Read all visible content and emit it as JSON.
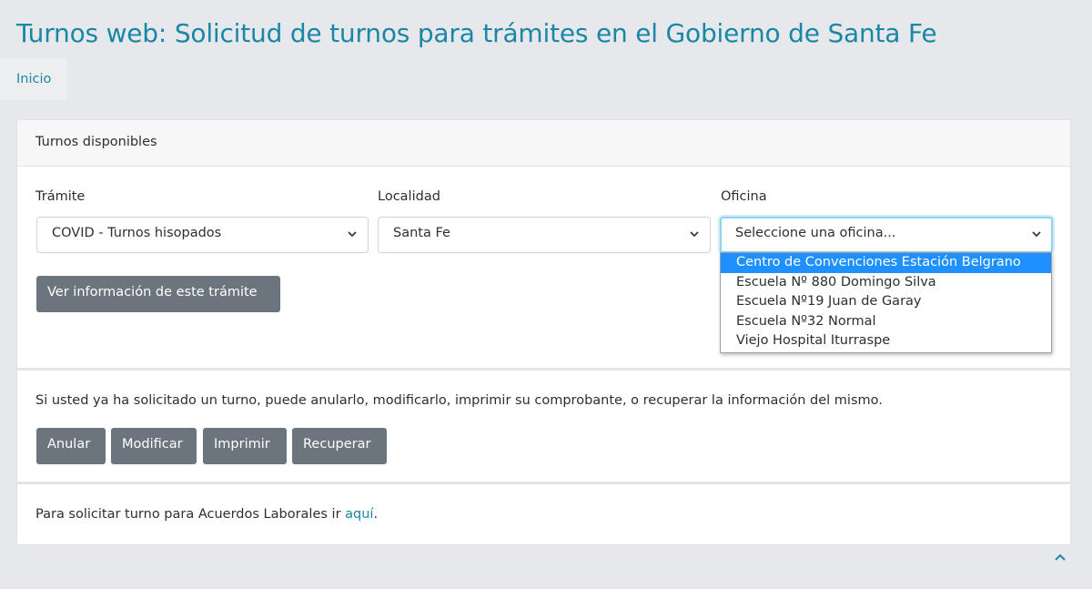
{
  "header": {
    "title": "Turnos web: Solicitud de turnos para trámites en el Gobierno de Santa Fe",
    "breadcrumb": "Inicio"
  },
  "turnos_card": {
    "header": "Turnos disponibles",
    "tramite": {
      "label": "Trámite",
      "value": "COVID - Turnos hisopados"
    },
    "localidad": {
      "label": "Localidad",
      "value": "Santa Fe"
    },
    "oficina": {
      "label": "Oficina",
      "placeholder": "Seleccione una oficina...",
      "options": [
        "Centro de Convenciones Estación Belgrano",
        "Escuela Nº 880 Domingo Silva",
        "Escuela Nº19 Juan de Garay",
        "Escuela Nº32 Normal",
        "Viejo Hospital Iturraspe"
      ],
      "highlighted_option": "Centro de Convenciones Estación Belgrano"
    },
    "info_button": "Ver información de este trámite"
  },
  "manage_card": {
    "text": "Si usted ya ha solicitado un turno, puede anularlo, modificarlo, imprimir su comprobante, o recuperar la información del mismo.",
    "buttons": {
      "anular": "Anular",
      "modificar": "Modificar",
      "imprimir": "Imprimir",
      "recuperar": "Recuperar"
    }
  },
  "labor_card": {
    "text_before": "Para solicitar turno para Acuerdos Laborales ir ",
    "link": "aquí",
    "text_after": "."
  },
  "icons": {
    "select_chevron": "chevron-down-icon",
    "scroll_top": "chevron-up-icon"
  },
  "colors": {
    "accent": "#1a87a6",
    "button": "#6c757d",
    "selected_option": "#1e90ff",
    "background": "#e6e8eb"
  }
}
